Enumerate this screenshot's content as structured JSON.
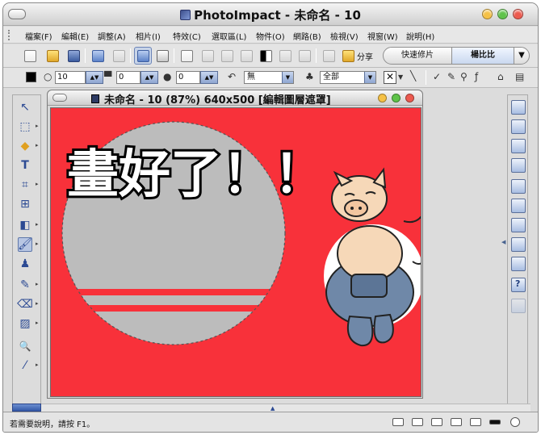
{
  "app": {
    "title": "PhotoImpact - 未命名 - 10",
    "menu": [
      "檔案(F)",
      "編輯(E)",
      "調整(A)",
      "相片(I)",
      "特效(C)",
      "選取區(L)",
      "物件(O)",
      "網路(B)",
      "檢視(V)",
      "視窗(W)",
      "說明(H)"
    ]
  },
  "toolbar": {
    "share_label": "分享",
    "mode_quick": "快速修片",
    "mode_full": "楊比比",
    "mode_menu_icon": "▼"
  },
  "attributes": {
    "size1": "10",
    "size2": "0",
    "size3": "0",
    "fill_mode": "無",
    "apply_to": "全部",
    "spin_arrows": "▲▼",
    "dropdown_arrow": "▼"
  },
  "document": {
    "title": "未命名 - 10 (87%) 640x500 [編輯圖層遮罩]",
    "headline": "畫好了！！"
  },
  "status": {
    "hint": "若需要說明，請按 F1。"
  },
  "colors": {
    "canvas_bg": "#f8313a",
    "selection_fill": "#bcbcbc",
    "stripe": "#f8313a"
  },
  "icons": {
    "more_arrow": "▸",
    "pointer": "↖",
    "text_tool": "T",
    "zoom": "🔍",
    "scroll_marker": "▲",
    "collapse": "◀"
  }
}
